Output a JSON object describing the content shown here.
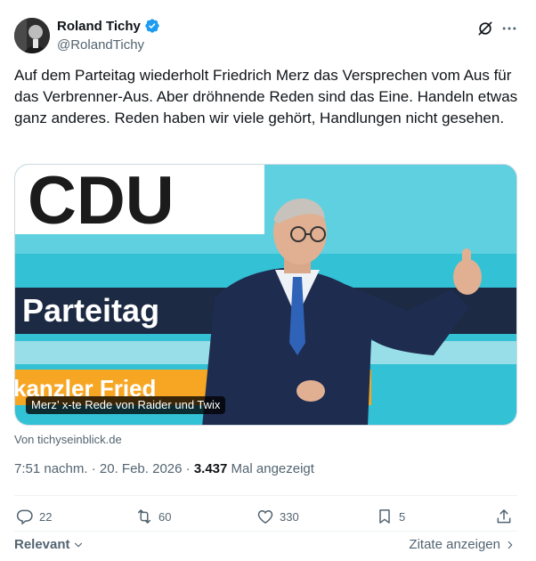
{
  "author": {
    "name": "Roland Tichy",
    "handle": "@RolandTichy"
  },
  "tweet": {
    "text": "Auf dem Parteitag wiederholt Friedrich Merz das Versprechen vom Aus für das Verbrenner-Aus. Aber dröhnende Reden sind das Eine. Handeln etwas ganz anderes. Reden haben wir viele gehört, Handlungen nicht gesehen."
  },
  "media": {
    "backdrop_logo": "CDU",
    "backdrop_banner": "Parteitag",
    "backdrop_subline": "kanzler Fried",
    "caption": "Merz’ x-te Rede von Raider und Twix",
    "source": "Von tichyseinblick.de"
  },
  "meta": {
    "time": "7:51 nachm.",
    "date": "20. Feb. 2026",
    "views_count": "3.437",
    "views_label": "Mal angezeigt"
  },
  "actions": {
    "replies": "22",
    "reposts": "60",
    "likes": "330",
    "bookmarks": "5"
  },
  "footer": {
    "sort_label": "Relevant",
    "quotes_label": "Zitate anzeigen"
  },
  "colors": {
    "verified_blue": "#1d9bf0",
    "secondary_text": "#536471",
    "backdrop_cyan": "#33c1d6"
  }
}
